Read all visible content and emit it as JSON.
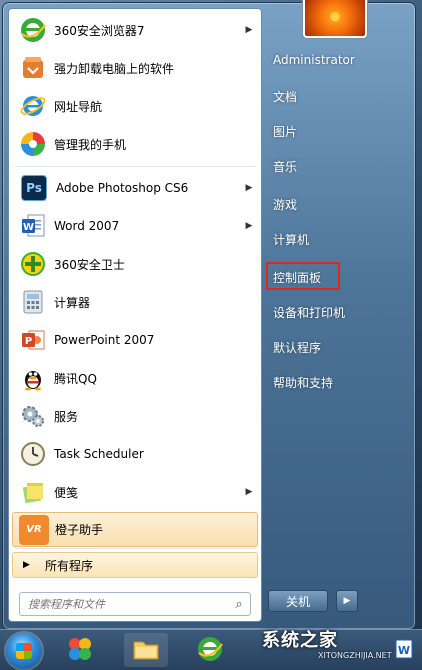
{
  "left_pane": {
    "pinned": [
      {
        "label": "360安全浏览器7",
        "icon": "360-browser-icon",
        "has_arrow": true
      },
      {
        "label": "强力卸载电脑上的软件",
        "icon": "uninstaller-icon",
        "has_arrow": false
      },
      {
        "label": "网址导航",
        "icon": "ie-icon",
        "has_arrow": false
      },
      {
        "label": "管理我的手机",
        "icon": "phone-manager-icon",
        "has_arrow": false
      }
    ],
    "recent": [
      {
        "label": "Adobe Photoshop CS6",
        "icon": "photoshop-icon",
        "has_arrow": true
      },
      {
        "label": "Word 2007",
        "icon": "word-icon",
        "has_arrow": true
      },
      {
        "label": "360安全卫士",
        "icon": "360-safeguard-icon",
        "has_arrow": false
      },
      {
        "label": "计算器",
        "icon": "calculator-icon",
        "has_arrow": false
      },
      {
        "label": "PowerPoint 2007",
        "icon": "powerpoint-icon",
        "has_arrow": false
      },
      {
        "label": "腾讯QQ",
        "icon": "qq-icon",
        "has_arrow": false
      },
      {
        "label": "服务",
        "icon": "services-icon",
        "has_arrow": false
      },
      {
        "label": "Task Scheduler",
        "icon": "task-scheduler-icon",
        "has_arrow": false
      },
      {
        "label": "便笺",
        "icon": "sticky-notes-icon",
        "has_arrow": true
      },
      {
        "label": "橙子助手",
        "icon": "vr-helper-icon",
        "has_arrow": false
      }
    ],
    "all_programs": "所有程序",
    "search_placeholder": "搜索程序和文件"
  },
  "right_pane": {
    "items": [
      "Administrator",
      "文档",
      "图片",
      "音乐",
      "游戏",
      "计算机",
      "控制面板",
      "设备和打印机",
      "默认程序",
      "帮助和支持"
    ],
    "highlighted": "控制面板",
    "shutdown_label": "关机"
  },
  "watermark": {
    "text": "系统之家",
    "sub": "XITONGZHIJIA.NET"
  },
  "colors": {
    "highlight_box": "#e2251f",
    "selected_item": "#f8dfae"
  }
}
